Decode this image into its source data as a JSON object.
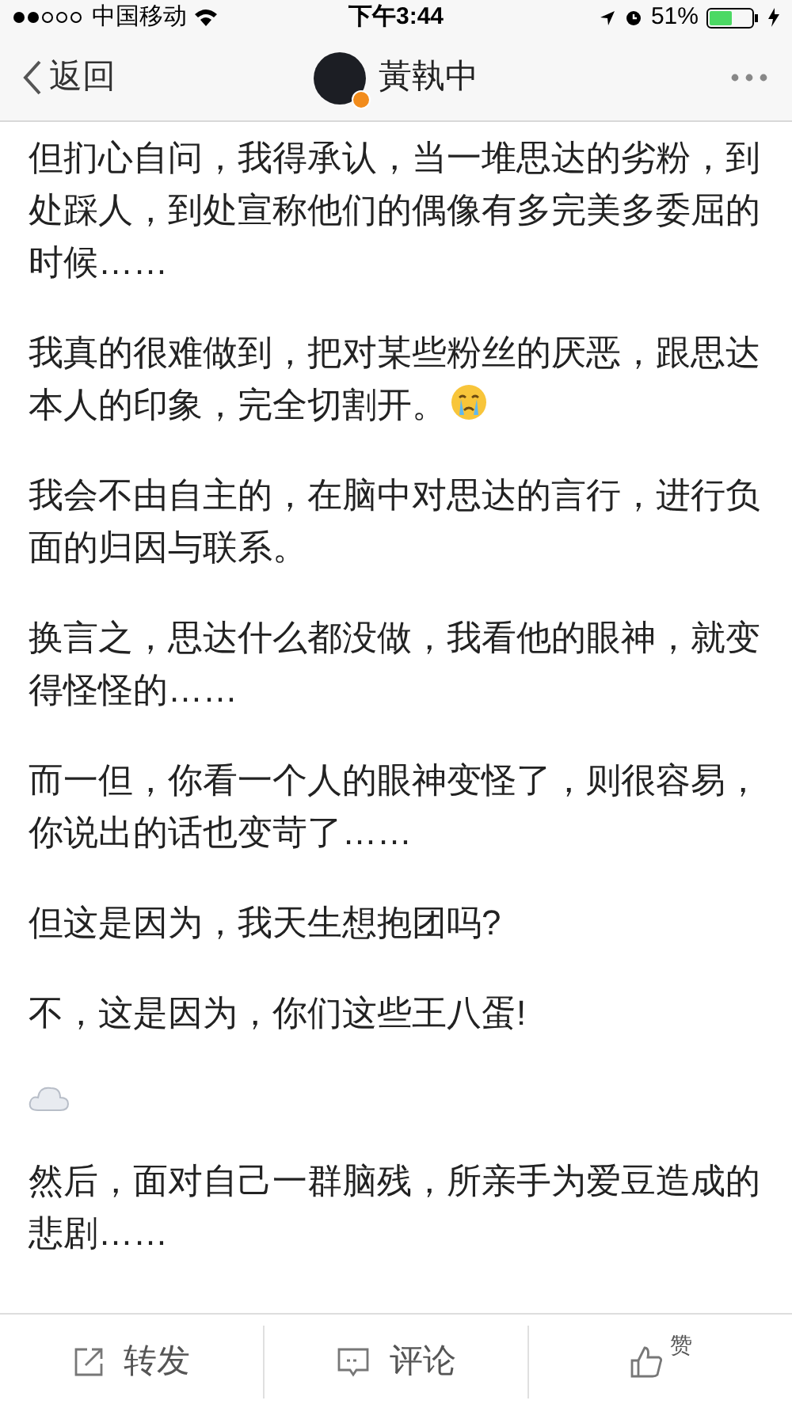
{
  "status_bar": {
    "carrier": "中国移动",
    "time": "下午3:44",
    "battery": "51%"
  },
  "nav": {
    "back": "返回",
    "title": "黃執中"
  },
  "post": [
    {
      "kind": "text",
      "text": "但扪心自问，我得承认，当一堆思达的劣粉，到处踩人，到处宣称他们的偶像有多完美多委屈的时候……",
      "trailing_emoji": false
    },
    {
      "kind": "text",
      "text": "我真的很难做到，把对某些粉丝的厌恶，跟思达本人的印象，完全切割开。",
      "trailing_emoji": true
    },
    {
      "kind": "text",
      "text": "我会不由自主的，在脑中对思达的言行，进行负面的归因与联系。",
      "trailing_emoji": false
    },
    {
      "kind": "text",
      "text": "换言之，思达什么都没做，我看他的眼神，就变得怪怪的……",
      "trailing_emoji": false
    },
    {
      "kind": "text",
      "text": "而一但，你看一个人的眼神变怪了，则很容易，你说出的话也变苛了……",
      "trailing_emoji": false
    },
    {
      "kind": "text",
      "text": "但这是因为，我天生想抱团吗?",
      "trailing_emoji": false
    },
    {
      "kind": "text",
      "text": "不，这是因为，你们这些王八蛋!",
      "trailing_emoji": false
    },
    {
      "kind": "emoji"
    },
    {
      "kind": "text",
      "text": "然后，面对自己一群脑残，所亲手为爱豆造成的悲剧……",
      "trailing_emoji": false
    }
  ],
  "actions": [
    {
      "kind": "share",
      "label": "转发"
    },
    {
      "kind": "comment",
      "label": "评论"
    },
    {
      "kind": "like",
      "label": "赞"
    }
  ]
}
